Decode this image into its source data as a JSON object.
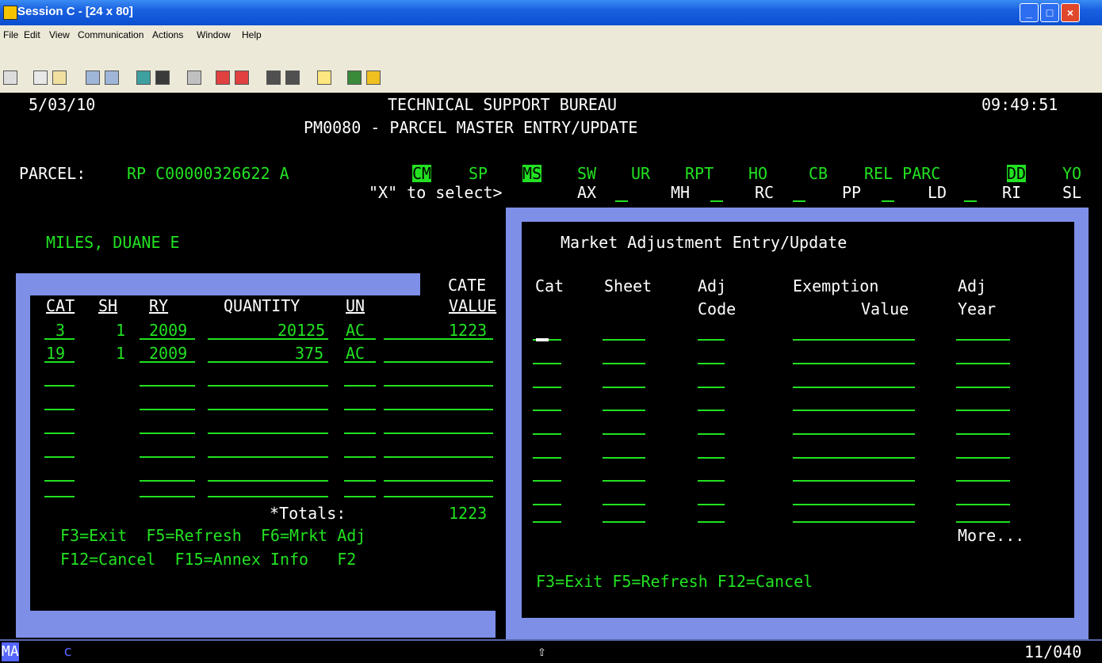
{
  "window": {
    "title": "Session C - [24 x 80]"
  },
  "menu": [
    "File",
    "Edit",
    "View",
    "Communication",
    "Actions",
    "Window",
    "Help"
  ],
  "header": {
    "date": "5/03/10",
    "bureau": "TECHNICAL SUPPORT BUREAU",
    "time": "09:49:51",
    "program": "PM0080 - PARCEL MASTER ENTRY/UPDATE"
  },
  "parcel": {
    "label": "PARCEL:",
    "value": "RP C00000326622 A",
    "codes_row1": [
      "CM",
      "SP",
      "MS",
      "SW",
      "UR",
      "RPT",
      "HO",
      "CB",
      "REL PARC",
      "DD",
      "YO"
    ],
    "select_prompt": "\"X\" to select>",
    "codes_row2": [
      "AX",
      "MH",
      "RC",
      "PP",
      "LD",
      "RI",
      "SL"
    ]
  },
  "owner": "MILES, DUANE E",
  "left_table": {
    "cate_label": "CATE",
    "headers": [
      "CAT",
      "SH",
      "RY",
      "QUANTITY",
      "UN",
      "VALUE"
    ],
    "rows": [
      {
        "cat": "3",
        "sh": "1",
        "ry": "2009",
        "quantity": "20125",
        "un": "AC",
        "value": "1223"
      },
      {
        "cat": "19",
        "sh": "1",
        "ry": "2009",
        "quantity": "375",
        "un": "AC",
        "value": ""
      }
    ],
    "totals_label": "*Totals:",
    "totals_value": "1223",
    "fkeys1": "F3=Exit  F5=Refresh  F6=Mrkt Adj",
    "fkeys2": "F12=Cancel  F15=Annex Info   F2"
  },
  "popup": {
    "title": "Market Adjustment Entry/Update",
    "col1_top": [
      "Cat",
      "Sheet",
      "Adj",
      "Exemption",
      "Adj"
    ],
    "col1_bottom": [
      "",
      "",
      "Code",
      "Value",
      "Year"
    ],
    "more": "More...",
    "fkeys": "F3=Exit F5=Refresh F12=Cancel"
  },
  "status": {
    "mode": "MA",
    "session": "c",
    "arrow": "⇧",
    "cursor_pos": "11/040"
  }
}
